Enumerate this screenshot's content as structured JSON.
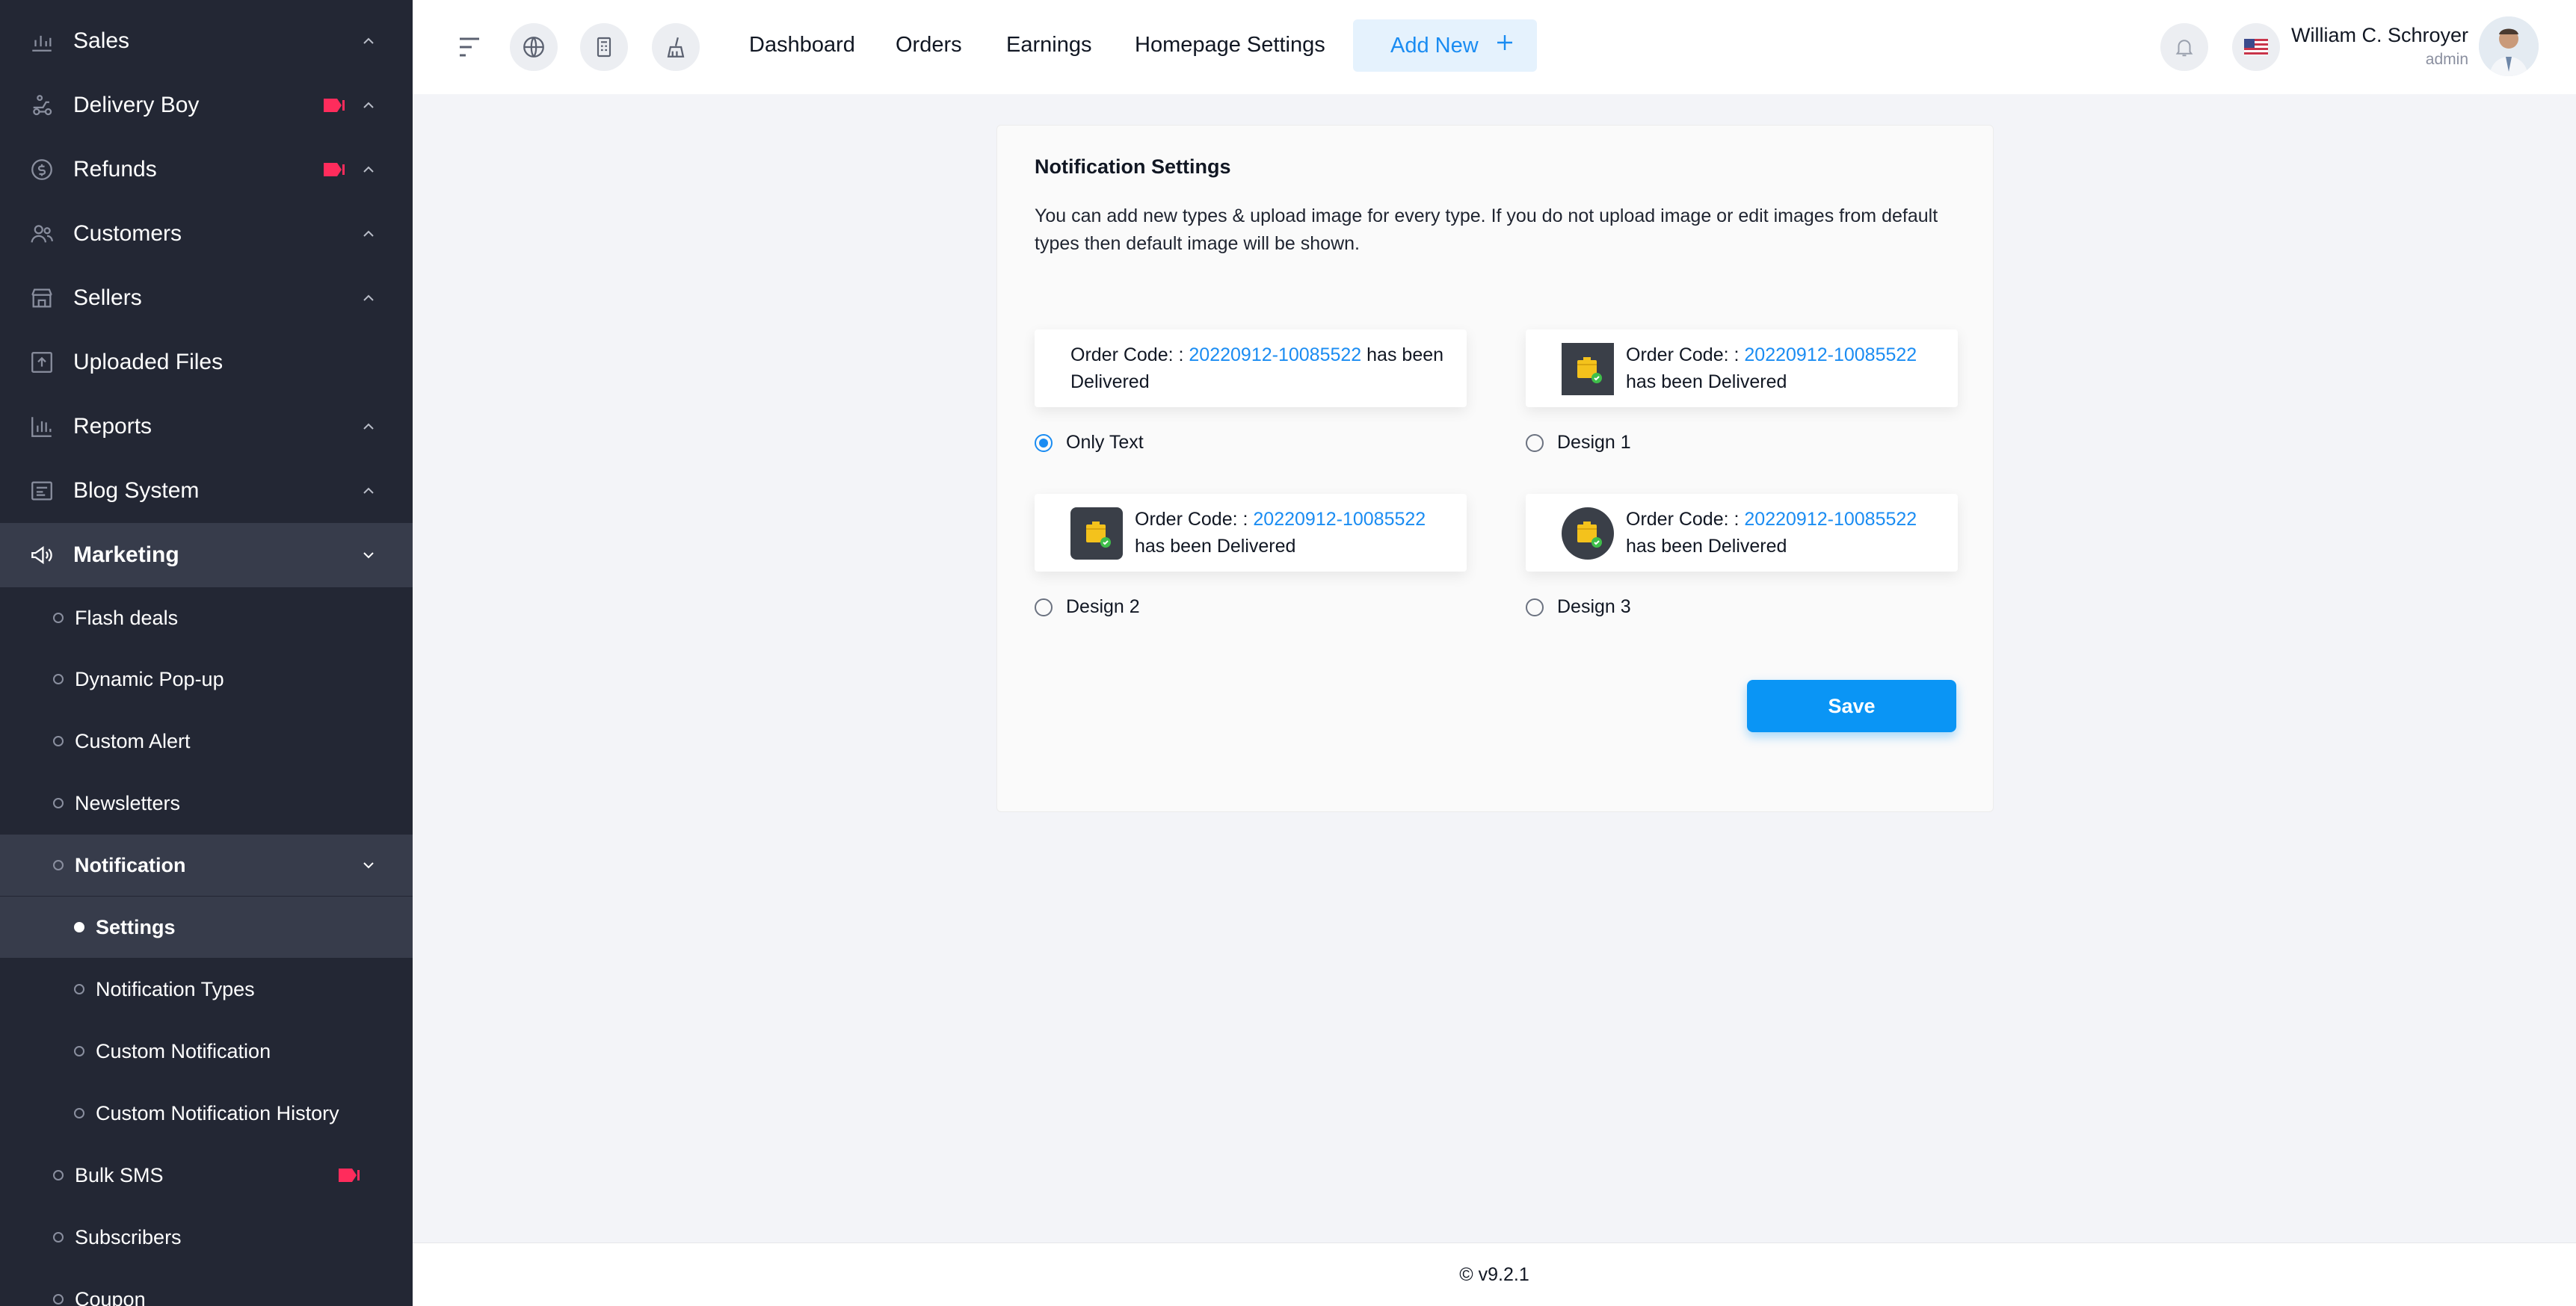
{
  "sidebar": {
    "top_items": [
      {
        "label": "Sales",
        "icon": "chart-bar-icon",
        "chevron": "up",
        "new_badge": false
      },
      {
        "label": "Delivery Boy",
        "icon": "delivery-icon",
        "chevron": "up",
        "new_badge": true
      },
      {
        "label": "Refunds",
        "icon": "refund-icon",
        "chevron": "up",
        "new_badge": true
      },
      {
        "label": "Customers",
        "icon": "users-icon",
        "chevron": "up",
        "new_badge": false
      },
      {
        "label": "Sellers",
        "icon": "store-icon",
        "chevron": "up",
        "new_badge": false
      },
      {
        "label": "Uploaded Files",
        "icon": "upload-icon",
        "chevron": "",
        "new_badge": false
      },
      {
        "label": "Reports",
        "icon": "report-icon",
        "chevron": "up",
        "new_badge": false
      },
      {
        "label": "Blog System",
        "icon": "blog-icon",
        "chevron": "up",
        "new_badge": false
      },
      {
        "label": "Marketing",
        "icon": "megaphone-icon",
        "chevron": "down",
        "new_badge": false
      }
    ],
    "marketing_items": [
      "Flash deals",
      "Dynamic Pop-up",
      "Custom Alert",
      "Newsletters",
      "Notification"
    ],
    "notification_items": [
      "Settings",
      "Notification Types",
      "Custom Notification",
      "Custom Notification History"
    ],
    "bottom_items": [
      "Bulk SMS",
      "Subscribers",
      "Coupon"
    ]
  },
  "topbar": {
    "links": [
      "Dashboard",
      "Orders",
      "Earnings",
      "Homepage Settings"
    ],
    "add_new": "Add New",
    "user_name": "William C. Schroyer",
    "user_role": "admin"
  },
  "card": {
    "title": "Notification Settings",
    "description": "You can add new types & upload image for every type. If you do not upload image or edit images from default types then default image will be shown.",
    "order_label": "Order Code: :",
    "order_code": "20220912-10085522",
    "delivered_text": "has been Delivered",
    "options": [
      "Only Text",
      "Design 1",
      "Design 2",
      "Design 3"
    ],
    "selected_option": "Only Text",
    "save_label": "Save"
  },
  "footer": {
    "version": "© v9.2.1"
  },
  "colors": {
    "sidebar_bg": "#232734",
    "accent": "#0a95f5",
    "link": "#1a8cf2",
    "badge": "#ff2c5c"
  }
}
